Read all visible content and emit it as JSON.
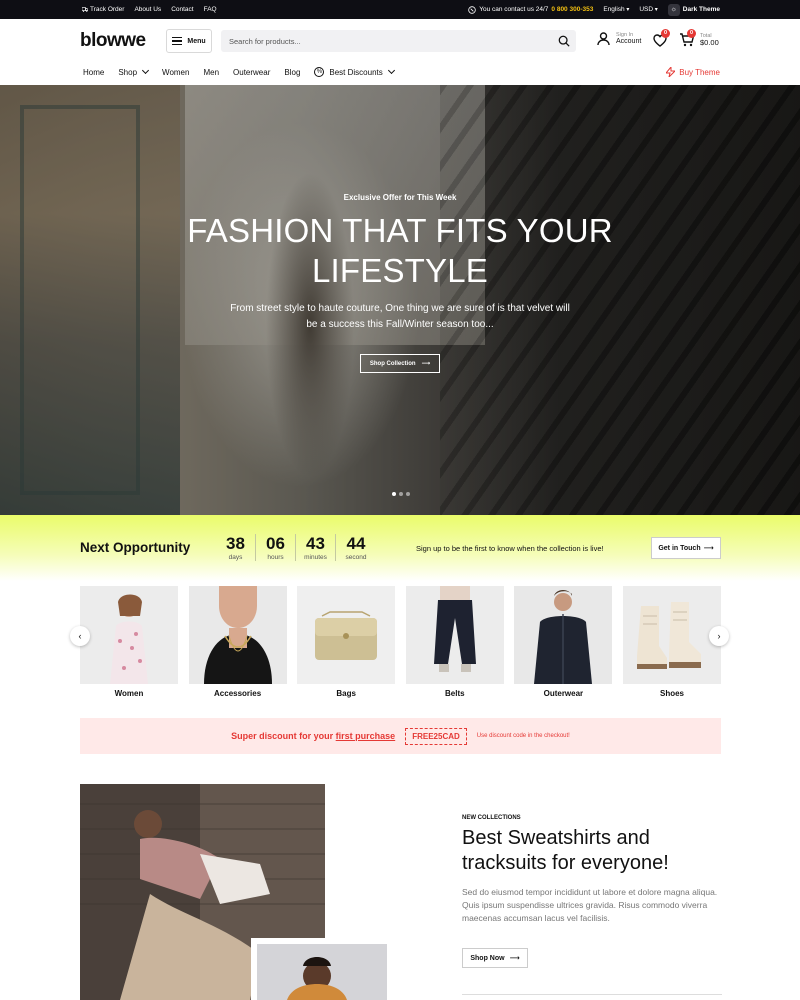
{
  "topbar": {
    "links": [
      "Track Order",
      "About Us",
      "Contact",
      "FAQ"
    ],
    "contact_text": "You can contact us 24/7",
    "phone": "0 800 300-353",
    "language": "English",
    "currency": "USD",
    "theme_toggle": "Dark Theme"
  },
  "header": {
    "logo": "blowwe",
    "menu_label": "Menu",
    "search_placeholder": "Search for products...",
    "account_small": "Sign In",
    "account_big": "Account",
    "wishlist_count": "0",
    "cart_count": "0",
    "cart_small": "Total",
    "cart_total": "$0.00"
  },
  "nav": {
    "items": [
      "Home",
      "Shop",
      "Women",
      "Men",
      "Outerwear",
      "Blog",
      "Best Discounts"
    ],
    "buy_theme": "Buy Theme"
  },
  "hero": {
    "eyebrow": "Exclusive Offer for This Week",
    "title_line1": "FASHION THAT FITS YOUR",
    "title_line2": "LIFESTYLE",
    "text": "From street style to haute couture, One thing we are sure of is that velvet will be a success this Fall/Winter season too...",
    "button": "Shop Collection",
    "slides": 3,
    "active_slide": 1
  },
  "countdown": {
    "title": "Next Opportunity",
    "units": [
      {
        "value": "38",
        "label": "days"
      },
      {
        "value": "06",
        "label": "hours"
      },
      {
        "value": "43",
        "label": "minutes"
      },
      {
        "value": "44",
        "label": "second"
      }
    ],
    "message": "Sign up to be the first to know when the collection is live!",
    "button": "Get in Touch"
  },
  "categories": [
    "Women",
    "Accessories",
    "Bags",
    "Belts",
    "Outerwear",
    "Shoes"
  ],
  "discount": {
    "text_before": "Super discount for your ",
    "text_link": "first purchase",
    "code": "FREE25CAD",
    "note": "Use discount code in the checkout!"
  },
  "collection": {
    "eyebrow": "NEW COLLECTIONS",
    "title": "Best Sweatshirts and tracksuits for everyone!",
    "text": "Sed do eiusmod tempor incididunt ut labore et dolore magna aliqua. Quis ipsum suspendisse ultrices gravida. Risus commodo viverra maecenas accumsan lacus vel facilisis.",
    "button": "Shop Now"
  },
  "colors": {
    "accent_red": "#e53935",
    "phone_yellow": "#f3c012",
    "countdown_lime": "#eafc6a",
    "topbar_bg": "#0e0e14"
  }
}
